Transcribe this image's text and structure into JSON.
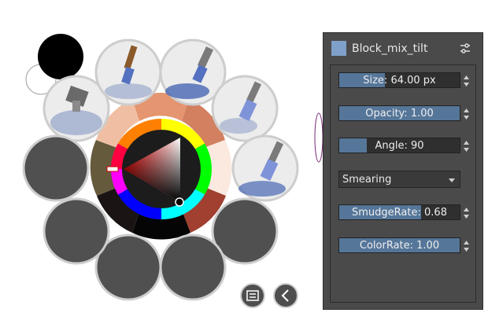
{
  "preset_panel": {
    "title": "Block_mix_tilt",
    "size_label": "Size:",
    "size_value": "64.00 px",
    "opacity_label": "Opacity:",
    "opacity_value": "1.00",
    "angle_label": "Angle:",
    "angle_value": "90",
    "blend_mode": "Smearing",
    "smudge_label": "SmudgeRate:",
    "smudge_value": "0.68",
    "color_label": "ColorRate:",
    "color_value": "1.00",
    "size_fraction": 0.38,
    "opacity_fraction": 1.0,
    "angle_fraction": 0.23,
    "smudge_fraction": 0.68,
    "color_fraction": 1.0
  },
  "colors": {
    "foreground": "#000000",
    "background": "#ffffff",
    "panel_bg": "#4a4a4a",
    "slider_fill": "#557699",
    "slot_empty": "#505050",
    "slot_ring": "#cdcdcd"
  },
  "icons": {
    "bottom_left": "list-icon",
    "bottom_right": "chevron-left-icon"
  }
}
